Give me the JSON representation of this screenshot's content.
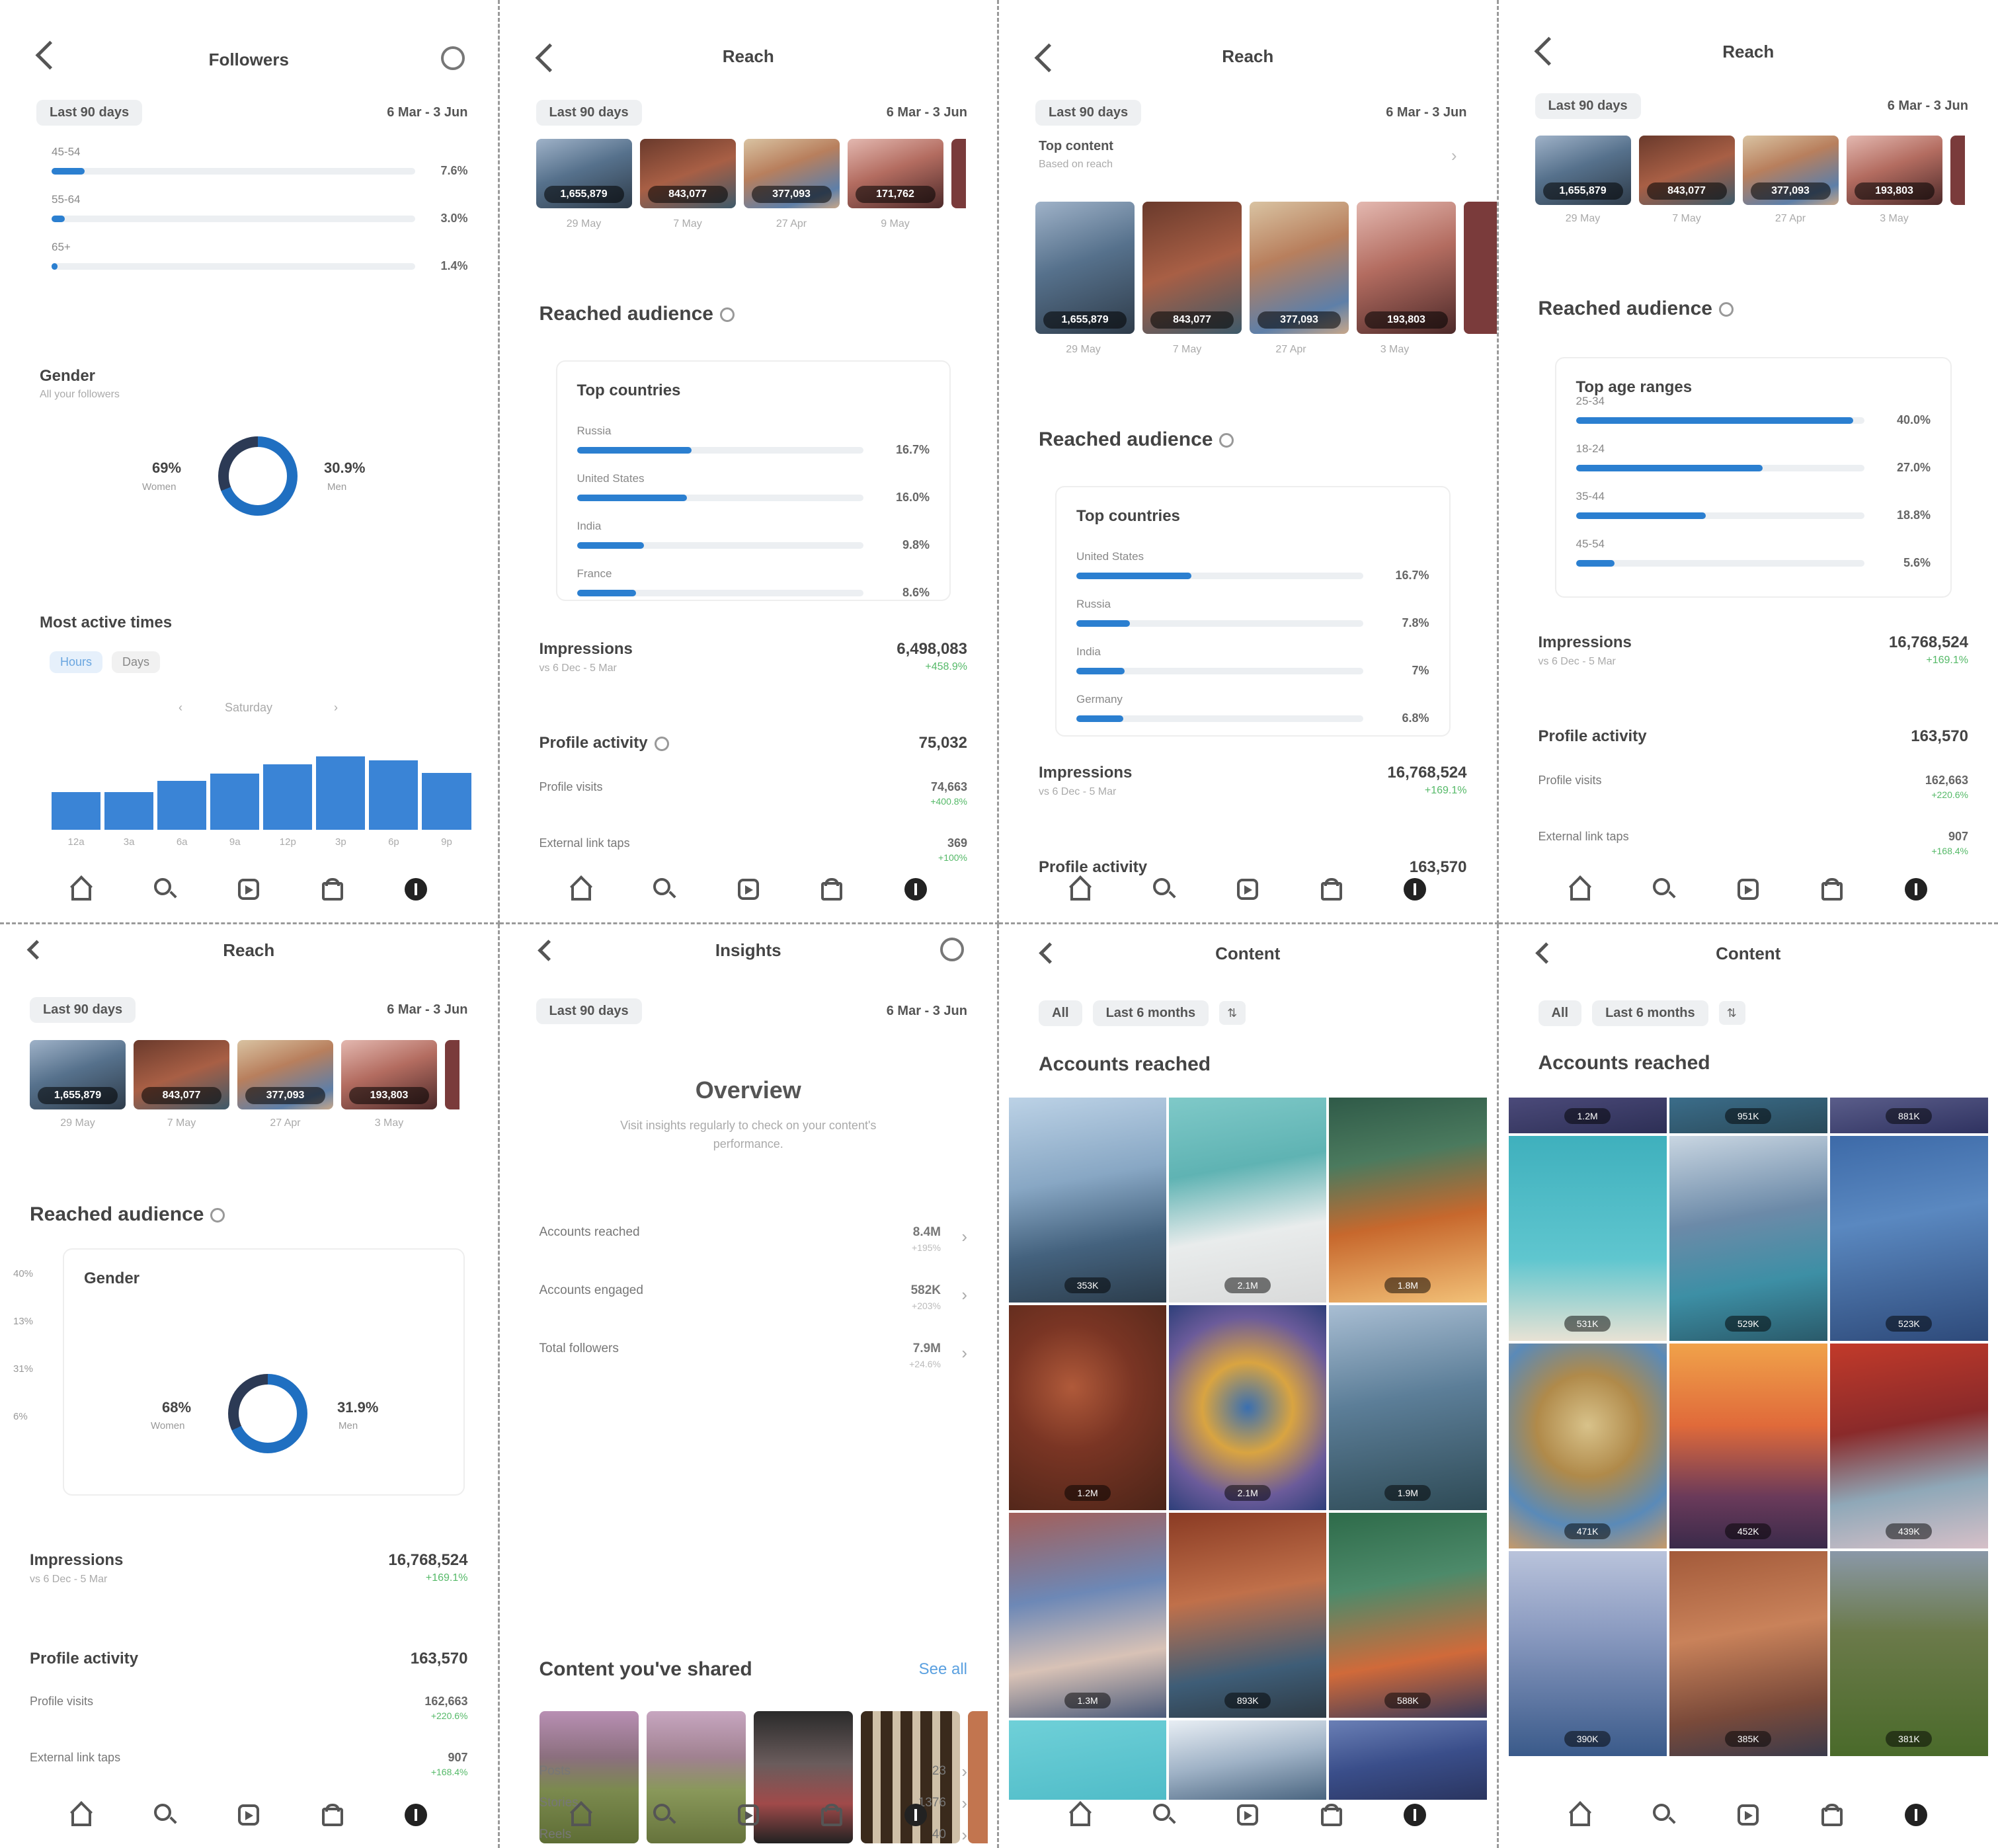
{
  "nav_icons": [
    "home-icon",
    "search-icon",
    "reels-icon",
    "shop-icon",
    "profile-icon"
  ],
  "p1": {
    "title": "Followers",
    "chip": "Last 90 days",
    "range": "6 Mar - 3 Jun",
    "age_rows": [
      {
        "label": "45-54",
        "pct": "7.6%",
        "fill": 0.076
      },
      {
        "label": "55-64",
        "pct": "3.0%",
        "fill": 0.03
      },
      {
        "label": "65+",
        "pct": "1.4%",
        "fill": 0.014
      }
    ],
    "gender_title": "Gender",
    "gender_sub": "All your followers",
    "left_pct": "69%",
    "left_label": "Women",
    "right_pct": "30.9%",
    "right_label": "Men",
    "women_fraction": 0.69,
    "active_title": "Most active times",
    "tab_hours": "Hours",
    "tab_days": "Days",
    "day": "Saturday",
    "bars": [
      0.42,
      0.42,
      0.55,
      0.63,
      0.73,
      0.82,
      0.78,
      0.64
    ],
    "hours": [
      "12a",
      "3a",
      "6a",
      "9a",
      "12p",
      "3p",
      "6p",
      "9p"
    ]
  },
  "p2": {
    "title": "Reach",
    "chip": "Last 90 days",
    "range": "6 Mar - 3 Jun",
    "thumbs": [
      "1,655,879",
      "843,077",
      "377,093",
      "171,762"
    ],
    "thumb_dates": [
      "29 May",
      "7 May",
      "27 Apr",
      "9 May"
    ],
    "section": "Reached audience",
    "card_title": "Top countries",
    "rows": [
      {
        "label": "Russia",
        "pct": "16.7%",
        "fill": 0.167
      },
      {
        "label": "United States",
        "pct": "16.0%",
        "fill": 0.16
      },
      {
        "label": "India",
        "pct": "9.8%",
        "fill": 0.098
      },
      {
        "label": "France",
        "pct": "8.6%",
        "fill": 0.086
      }
    ],
    "impressions_label": "Impressions",
    "impressions_value": "6,498,083",
    "impressions_sub": "vs 6 Dec - 5 Mar",
    "impressions_growth": "+458.9%",
    "profile_label": "Profile activity",
    "profile_value": "75,032",
    "visits_label": "Profile visits",
    "visits_value": "74,663",
    "visits_growth": "+400.8%",
    "ext_label": "External link taps",
    "ext_value": "369",
    "ext_growth": "+100%"
  },
  "p3": {
    "title": "Reach",
    "chip": "Last 90 days",
    "range": "6 Mar - 3 Jun",
    "top_content": "Top content",
    "top_content_sub": "Based on reach",
    "thumbs": [
      "1,655,879",
      "843,077",
      "377,093",
      "193,803"
    ],
    "thumb_dates": [
      "29 May",
      "7 May",
      "27 Apr",
      "3 May"
    ],
    "section": "Reached audience",
    "card_title": "Top countries",
    "rows": [
      {
        "label": "United States",
        "pct": "16.7%",
        "fill": 0.167
      },
      {
        "label": "Russia",
        "pct": "7.8%",
        "fill": 0.078
      },
      {
        "label": "India",
        "pct": "7%",
        "fill": 0.07
      },
      {
        "label": "Germany",
        "pct": "6.8%",
        "fill": 0.068
      }
    ],
    "impressions_label": "Impressions",
    "impressions_value": "16,768,524",
    "impressions_sub": "vs 6 Dec - 5 Mar",
    "impressions_growth": "+169.1%",
    "profile_label": "Profile activity",
    "profile_value": "163,570"
  },
  "p4": {
    "title": "Reach",
    "chip": "Last 90 days",
    "range": "6 Mar - 3 Jun",
    "thumbs": [
      "1,655,879",
      "843,077",
      "377,093",
      "193,803"
    ],
    "thumb_dates": [
      "29 May",
      "7 May",
      "27 Apr",
      "3 May"
    ],
    "section": "Reached audience",
    "card_title": "Top age ranges",
    "rows": [
      {
        "label": "25-34",
        "pct": "40.0%",
        "fill": 0.4
      },
      {
        "label": "18-24",
        "pct": "27.0%",
        "fill": 0.27
      },
      {
        "label": "35-44",
        "pct": "18.8%",
        "fill": 0.188
      },
      {
        "label": "45-54",
        "pct": "5.6%",
        "fill": 0.056
      }
    ],
    "impressions_label": "Impressions",
    "impressions_value": "16,768,524",
    "impressions_sub": "vs 6 Dec - 5 Mar",
    "impressions_growth": "+169.1%",
    "profile_label": "Profile activity",
    "profile_value": "163,570",
    "visits_label": "Profile visits",
    "visits_value": "162,663",
    "visits_growth": "+220.6%",
    "ext_label": "External link taps",
    "ext_value": "907",
    "ext_growth": "+168.4%"
  },
  "p5": {
    "title": "Reach",
    "chip": "Last 90 days",
    "range": "6 Mar - 3 Jun",
    "thumbs": [
      "1,655,879",
      "843,077",
      "377,093",
      "193,803"
    ],
    "thumb_dates": [
      "29 May",
      "7 May",
      "27 Apr",
      "3 May"
    ],
    "section": "Reached audience",
    "card_title": "Gender",
    "side_pcts": [
      "40%",
      "13%",
      "31%",
      "6%"
    ],
    "left_pct": "68%",
    "left_label": "Women",
    "right_pct": "31.9%",
    "right_label": "Men",
    "women_fraction": 0.68,
    "impressions_label": "Impressions",
    "impressions_value": "16,768,524",
    "impressions_sub": "vs 6 Dec - 5 Mar",
    "impressions_growth": "+169.1%",
    "profile_label": "Profile activity",
    "profile_value": "163,570",
    "visits_label": "Profile visits",
    "visits_value": "162,663",
    "visits_growth": "+220.6%",
    "ext_label": "External link taps",
    "ext_value": "907",
    "ext_growth": "+168.4%"
  },
  "p6": {
    "title": "Insights",
    "chip": "Last 90 days",
    "range": "6 Mar - 3 Jun",
    "overview": "Overview",
    "overview_sub": "Visit insights regularly to check on your content's performance.",
    "rows": [
      {
        "label": "Accounts reached",
        "value": "8.4M",
        "sub": "+195%"
      },
      {
        "label": "Accounts engaged",
        "value": "582K",
        "sub": "+203%"
      },
      {
        "label": "Total followers",
        "value": "7.9M",
        "sub": "+24.6%"
      }
    ],
    "shared_title": "Content you've shared",
    "see_all": "See all",
    "counts": [
      {
        "label": "Posts",
        "value": "23"
      },
      {
        "label": "Stories",
        "value": "1376"
      },
      {
        "label": "Reels",
        "value": "40"
      }
    ]
  },
  "p7": {
    "title": "Content",
    "filter_all": "All",
    "filter_period": "Last 6 months",
    "section": "Accounts reached",
    "badges": [
      "353K",
      "2.1M",
      "1.8M",
      "1.2M",
      "2.1M",
      "1.9M",
      "1.3M",
      "893K",
      "588K",
      "",
      "",
      ""
    ]
  },
  "p8": {
    "title": "Content",
    "filter_all": "All",
    "filter_period": "Last 6 months",
    "section": "Accounts reached",
    "top_badges": [
      "1.2M",
      "951K",
      "881K"
    ],
    "badges": [
      "531K",
      "529K",
      "523K",
      "471K",
      "452K",
      "439K",
      "390K",
      "385K",
      "381K"
    ]
  }
}
